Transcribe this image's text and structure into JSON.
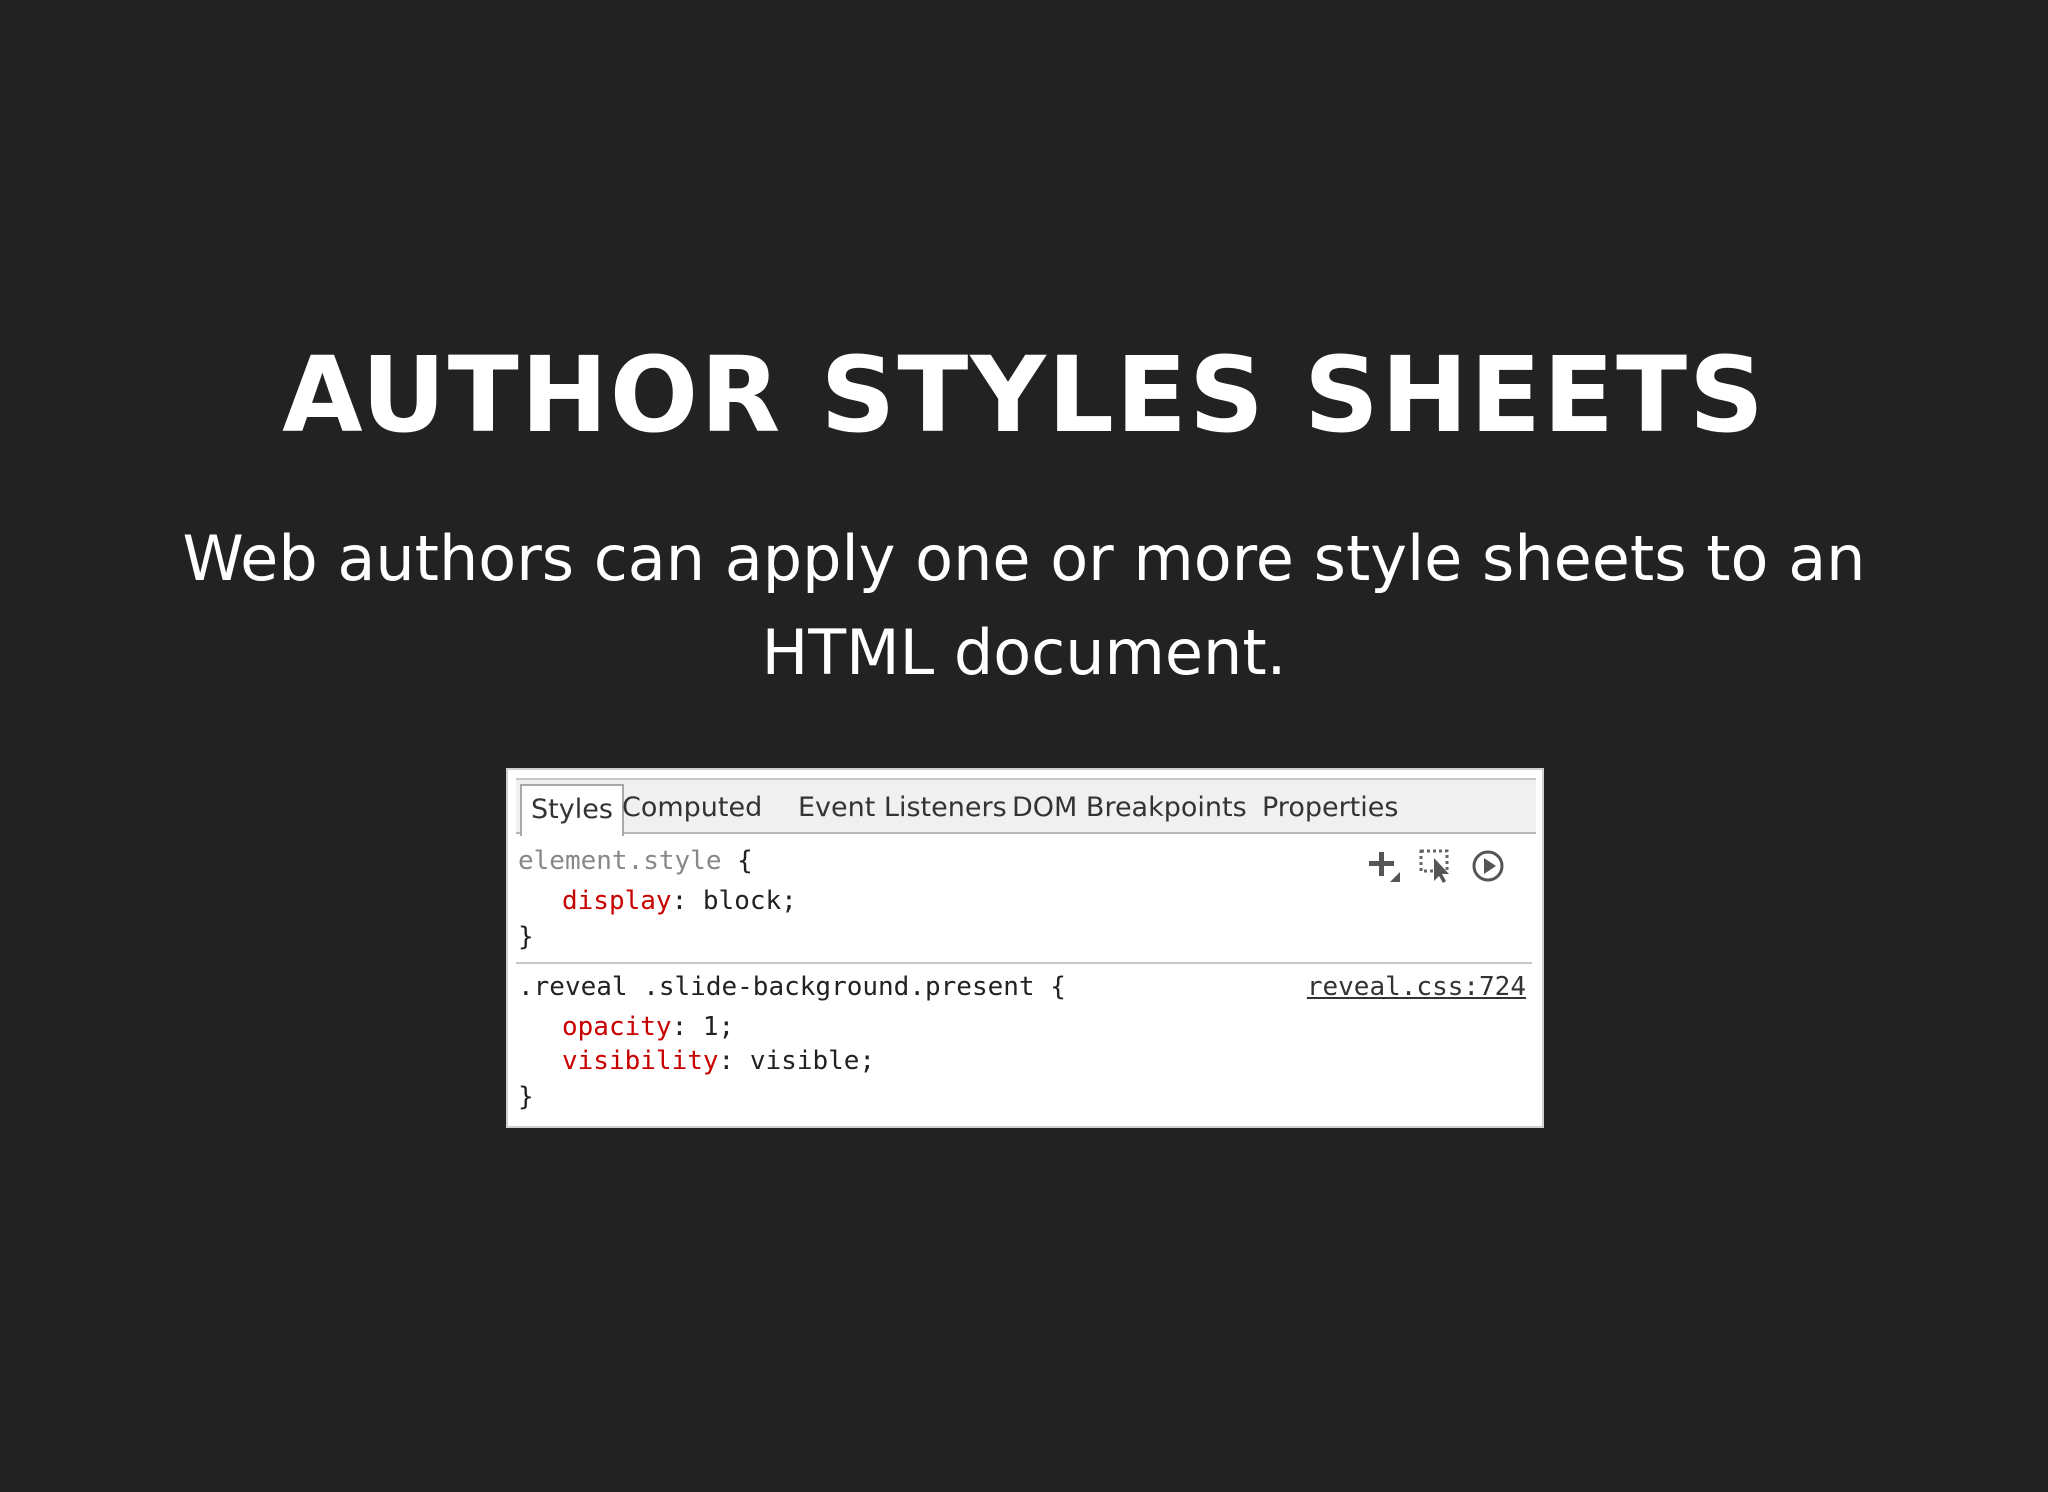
{
  "slide": {
    "title": "AUTHOR STYLES SHEETS",
    "subtitle": "Web authors can apply one or more style sheets to an HTML document."
  },
  "devtools": {
    "tabs": [
      {
        "label": "Styles",
        "active": true
      },
      {
        "label": "Computed",
        "active": false
      },
      {
        "label": "Event Listeners",
        "active": false
      },
      {
        "label": "DOM Breakpoints",
        "active": false
      },
      {
        "label": "Properties",
        "active": false
      }
    ],
    "toolbar_icons": [
      "new-style-rule-icon",
      "element-state-icon",
      "play-circle-icon"
    ],
    "rules": [
      {
        "selector": "element.style",
        "open_brace": "{",
        "close_brace": "}",
        "source": "",
        "declarations": [
          {
            "property": "display",
            "value": "block;"
          }
        ]
      },
      {
        "selector": ".reveal .slide-background.present",
        "open_brace": "{",
        "close_brace": "}",
        "source": "reveal.css:724",
        "declarations": [
          {
            "property": "opacity",
            "value": "1;"
          },
          {
            "property": "visibility",
            "value": "visible;"
          }
        ]
      }
    ]
  },
  "colors": {
    "background": "#222223",
    "text": "#ffffff",
    "css_property": "#c80000",
    "selector_dim": "#888888"
  }
}
